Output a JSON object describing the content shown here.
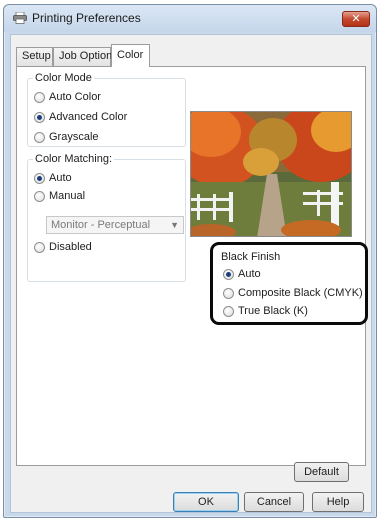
{
  "window": {
    "title": "Printing Preferences",
    "close_label": "✕"
  },
  "tabs": [
    {
      "label": "Setup"
    },
    {
      "label": "Job Options"
    },
    {
      "label": "Color"
    }
  ],
  "color_mode": {
    "label": "Color Mode",
    "options": [
      {
        "label": "Auto Color",
        "checked": false
      },
      {
        "label": "Advanced Color",
        "checked": true
      },
      {
        "label": "Grayscale",
        "checked": false
      }
    ]
  },
  "color_matching": {
    "label": "Color Matching:",
    "options": [
      {
        "label": "Auto",
        "checked": true
      },
      {
        "label": "Manual",
        "checked": false
      },
      {
        "label": "Disabled",
        "checked": false
      }
    ],
    "profile_value": "Monitor - Perceptual"
  },
  "black_finish": {
    "label": "Black Finish",
    "options": [
      {
        "label": "Auto",
        "checked": true
      },
      {
        "label": "Composite Black (CMYK)",
        "checked": false
      },
      {
        "label": "True Black (K)",
        "checked": false
      }
    ]
  },
  "buttons": {
    "default": "Default",
    "ok": "OK",
    "cancel": "Cancel",
    "help": "Help"
  },
  "icons": {
    "printer": "printer-icon",
    "close": "close-icon",
    "dropdown": "chevron-down-icon"
  },
  "colors": {
    "title_bar": "#c9d9ec",
    "close_button": "#c44a2e",
    "highlight_border": "#0a0a0a"
  }
}
